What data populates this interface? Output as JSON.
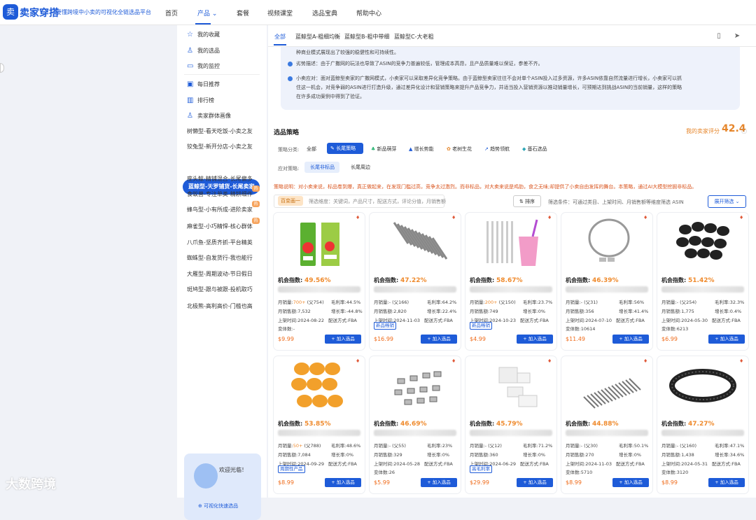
{
  "header": {
    "brand": "卖家穿搭",
    "slogan": "要懂跨境中小卖的可视化全链选品平台",
    "nav": [
      "首页",
      "产品",
      "套餐",
      "视频课堂",
      "选品宝典",
      "帮助中心"
    ]
  },
  "sidebar": {
    "top_items": [
      "我的收藏",
      "我的选品",
      "我的监控"
    ],
    "mid_items": [
      "每日推荐",
      "排行榜",
      "卖家群体画像"
    ],
    "groups": [
      {
        "label": "树懒型-看天吃饭-小卖之友",
        "hot": false
      },
      {
        "label": "狡兔型-新开分店-小卖之友",
        "hot": false
      },
      {
        "label": "蓝鲸型-天罗铺货-长尾卖家",
        "hot": false,
        "active": true
      },
      {
        "label": "座头鲸-精铺混合-长尾偏多",
        "hot": false
      },
      {
        "label": "食蚁兽-专注单类-精耕细作",
        "hot": true
      },
      {
        "label": "蜂鸟型-小有所成-进阶卖家",
        "hot": true
      },
      {
        "label": "麻雀型-小巧精悍-核心群体",
        "hot": true
      },
      {
        "label": "八爪鱼-坚质齐抓-平台精英",
        "hot": false
      },
      {
        "label": "蜘蛛型-自发货行-我也能行",
        "hot": false
      },
      {
        "label": "大雁型-周期波动-节日假日",
        "hot": false
      },
      {
        "label": "斑鸠型-跟与被跟-投机取巧",
        "hot": false
      },
      {
        "label": "北极熊-高利高价-门槛也高",
        "hot": false
      }
    ],
    "promo_text": "欢迎光临！",
    "promo_link": "可视化快速选品"
  },
  "tabs": [
    "全部",
    "蓝鲸型A-粗细均衡",
    "蓝鲸型B-粗中带细",
    "蓝鲸型C-大老粗"
  ],
  "description": {
    "line0": "种商业模式展现出了较强的稳健性和可持续性。",
    "bullet1": "劣势描述：由于广撒网的玩法也导致了ASIN的竞争力普遍较低，管理成本高昂，且产品质量难以保证，参差不齐。",
    "bullet2a": "小卖应对：面对蓝鲸型卖家的广撒网模式，小卖家可以采取差异化竞争策略。由于蓝鲸型卖家往往不会对单个ASIN投入过多资源，许多ASIN依靠自然流量进行增长，小卖家可以抓",
    "bullet2b": "住这一机会，对竞争弱的ASIN进行打造升级，通过差异化设计和营销策略来提升产品竞争力，并适当投入营销资源以推动销量增长，可预期达到挑战ASIN的当前销量，这样的策略",
    "bullet2c": "在许多成功案例中得到了验证。"
  },
  "strategy": {
    "title": "选品策略",
    "score_label": "我的卖家评分",
    "score": "42.4",
    "cat_label": "策略分类:",
    "categories": [
      "全部",
      "长尾策略",
      "新品萌芽",
      "增长势能",
      "老树生花",
      "趋势领航",
      "基石选品"
    ],
    "apply_label": "应对策略:",
    "apply": [
      "长尾非标品",
      "长尾周边"
    ],
    "note": "策略说明：对小卖来说，标品卷到爆，真正做起来，在发现门槛过高，竞争太过激烈。而非标品，对大卖来说是鸡肋，食之无味;却提供了小卖自由发挥的舞台。本策略，通过AI大模型挖掘非标品。",
    "filter_tag": "百变画一",
    "filter_hint": "筛选维度：关键词，产品尺寸，配送方式，评论分值，月销售额",
    "sort_label": "排序",
    "filter_cond": "筛选条件：可通过类目、上架时间、月销售额等维度筛选 ASIN",
    "expand_label": "展开筛选"
  },
  "labels": {
    "opp": "机会指数:",
    "monthly_sales": "月销量:",
    "monthly_revenue": "月销售额:",
    "listed": "上架时间:",
    "variants": "变体数:",
    "margin": "毛利率:",
    "growth": "增长率:",
    "delivery": "配送方式:",
    "add": "加入选品"
  },
  "products": [
    {
      "opp": "49.56%",
      "sales_hi": "700+",
      "sales_rest": " (父754)",
      "margin": "44.5%",
      "revenue": "7,532",
      "growth": "-44.8%",
      "listed": "2024-08-22",
      "delivery": "FBA",
      "variants": "-",
      "badge": "",
      "price": "$9.99"
    },
    {
      "opp": "47.22%",
      "sales_hi": "",
      "sales_rest": "- (父166)",
      "margin": "64.2%",
      "revenue": "2,820",
      "growth": "22.4%",
      "listed": "2024-11-03",
      "delivery": "FBA",
      "variants": "",
      "badge": "新品畅销",
      "price": "$16.99"
    },
    {
      "opp": "58.67%",
      "sales_hi": "200+",
      "sales_rest": " (父150)",
      "margin": "23.7%",
      "revenue": "749",
      "growth": "0%",
      "listed": "2024-10-23",
      "delivery": "FBA",
      "variants": "",
      "badge": "新品畅销",
      "price": "$4.99"
    },
    {
      "opp": "46.39%",
      "sales_hi": "",
      "sales_rest": "- (父31)",
      "margin": "56%",
      "revenue": "356",
      "growth": "41.4%",
      "listed": "2024-07-10",
      "delivery": "FBA",
      "variants": "10614",
      "badge": "",
      "price": "$11.49"
    },
    {
      "opp": "51.42%",
      "sales_hi": "",
      "sales_rest": "- (父254)",
      "margin": "32.3%",
      "revenue": "1,775",
      "growth": "0.4%",
      "listed": "2024-05-30",
      "delivery": "FBA",
      "variants": "6213",
      "badge": "",
      "price": "$6.99"
    },
    {
      "opp": "53.85%",
      "sales_hi": "50+",
      "sales_rest": " (父788)",
      "margin": "48.6%",
      "revenue": "7,084",
      "growth": "0%",
      "listed": "2024-09-29",
      "delivery": "FBA",
      "variants": "",
      "badge": "周期性产品",
      "price": "$8.99"
    },
    {
      "opp": "46.69%",
      "sales_hi": "",
      "sales_rest": "- (父55)",
      "margin": "23%",
      "revenue": "329",
      "growth": "0%",
      "listed": "2024-05-28",
      "delivery": "FBA",
      "variants": "26",
      "badge": "",
      "price": "$5.99"
    },
    {
      "opp": "45.79%",
      "sales_hi": "",
      "sales_rest": "- (父12)",
      "margin": "71.2%",
      "revenue": "360",
      "growth": "0%",
      "listed": "2024-06-29",
      "delivery": "FBA",
      "variants": "",
      "badge": "高毛利率",
      "price": "$29.99"
    },
    {
      "opp": "44.88%",
      "sales_hi": "",
      "sales_rest": "- (父30)",
      "margin": "50.1%",
      "revenue": "270",
      "growth": "0%",
      "listed": "2024-11-03",
      "delivery": "FBA",
      "variants": "5710",
      "badge": "",
      "price": "$8.99"
    },
    {
      "opp": "47.27%",
      "sales_hi": "",
      "sales_rest": "- (父160)",
      "margin": "47.1%",
      "revenue": "1,438",
      "growth": "34.6%",
      "listed": "2024-05-31",
      "delivery": "FBA",
      "variants": "3120",
      "badge": "",
      "price": "$8.99"
    }
  ],
  "watermark": "大数跨境"
}
